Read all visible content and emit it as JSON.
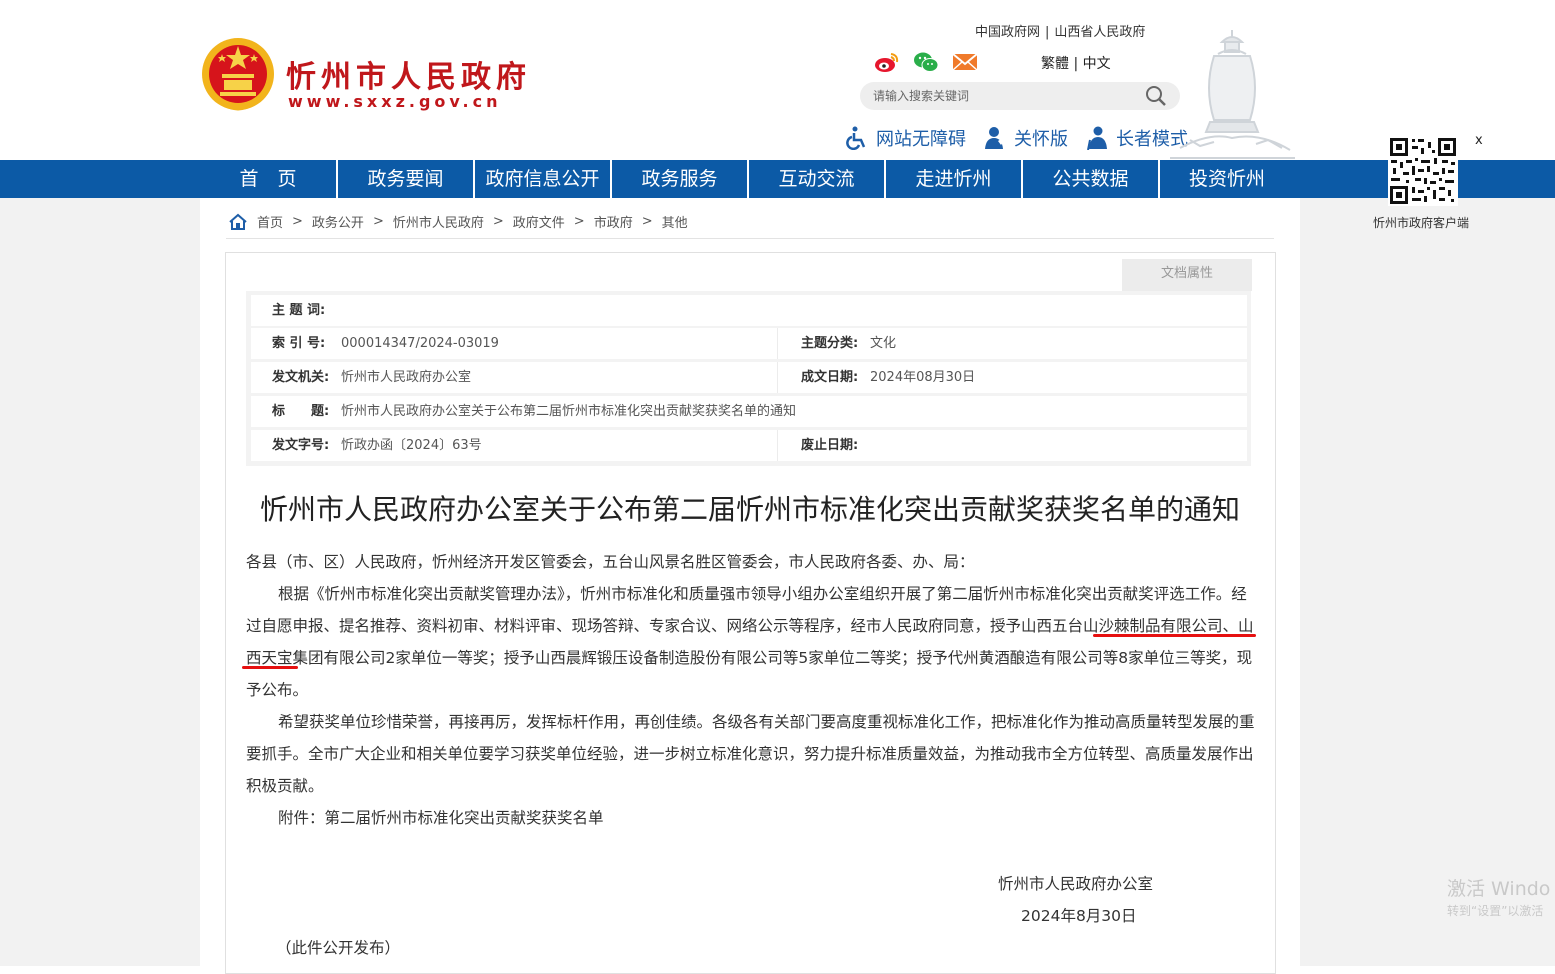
{
  "header": {
    "site_name": "忻州市人民政府",
    "site_url": "www.sxxz.gov.cn",
    "top_links": [
      "中国政府网",
      "山西省人民政府"
    ],
    "social_icons": [
      "weibo-icon",
      "wechat-icon",
      "email-icon"
    ],
    "lang": {
      "traditional": "繁體",
      "sep": "|",
      "simplified": "中文"
    },
    "search": {
      "placeholder": "请输入搜索关键词"
    },
    "modes": [
      "网站无障碍",
      "关怀版",
      "长者模式"
    ],
    "brand_color": "#c0171b"
  },
  "nav": {
    "items": [
      "首　页",
      "政务要闻",
      "政府信息公开",
      "政务服务",
      "互动交流",
      "走进忻州",
      "公共数据",
      "投资忻州"
    ],
    "bg_color": "#0c5aa6"
  },
  "qr": {
    "close": "x",
    "label": "忻州市政府客户端"
  },
  "breadcrumb": {
    "items": [
      "首页",
      "政务公开",
      "忻州市人民政府",
      "政府文件",
      "市政府",
      "其他"
    ],
    "sep": ">"
  },
  "attributes": {
    "tab_label": "文档属性",
    "subject_words": {
      "label": "主 题 词:",
      "value": ""
    },
    "index_no": {
      "label": "索 引 号:",
      "value": "000014347/2024-03019"
    },
    "category": {
      "label": "主题分类:",
      "value": "文化"
    },
    "issuer": {
      "label": "发文机关:",
      "value": "忻州市人民政府办公室"
    },
    "date": {
      "label": "成文日期:",
      "value": "2024年08月30日"
    },
    "title": {
      "label": "标　　题:",
      "value": "忻州市人民政府办公室关于公布第二届忻州市标准化突出贡献奖获奖名单的通知"
    },
    "doc_no": {
      "label": "发文字号:",
      "value": "忻政办函〔2024〕63号"
    },
    "expiry": {
      "label": "废止日期:",
      "value": ""
    }
  },
  "article": {
    "title": "忻州市人民政府办公室关于公布第二届忻州市标准化突出贡献奖获奖名单的通知",
    "salutation": "各县（市、区）人民政府，忻州经济开发区管委会，五台山风景名胜区管委会，市人民政府各委、办、局：",
    "para1": "根据《忻州市标准化突出贡献奖管理办法》，忻州市标准化和质量强市领导小组办公室组织开展了第二届忻州市标准化突出贡献奖评选工作。经过自愿申报、提名推荐、资料初审、材料评审、现场答辩、专家合议、网络公示等程序，经市人民政府同意，授予山西五台山沙棘制品有限公司、山西天宝集团有限公司2家单位一等奖；授予山西晨辉锻压设备制造股份有限公司等5家单位二等奖；授予代州黄酒酿造有限公司等8家单位三等奖，现予公布。",
    "para2": "希望获奖单位珍惜荣誉，再接再厉，发挥标杆作用，再创佳绩。各级各有关部门要高度重视标准化工作，把标准化作为推动高质量转型发展的重要抓手。全市广大企业和相关单位要学习获奖单位经验，进一步树立标准化意识，努力提升标准质量效益，为推动我市全方位转型、高质量发展作出积极贡献。",
    "attachment": "附件：第二届忻州市标准化突出贡献奖获奖名单",
    "signer": "忻州市人民政府办公室",
    "sign_date": "2024年8月30日",
    "note": "（此件公开发布）",
    "highlight_color": "#e61010"
  },
  "watermark": {
    "line1": "激活 Windo",
    "line2": "转到“设置”以激活"
  }
}
